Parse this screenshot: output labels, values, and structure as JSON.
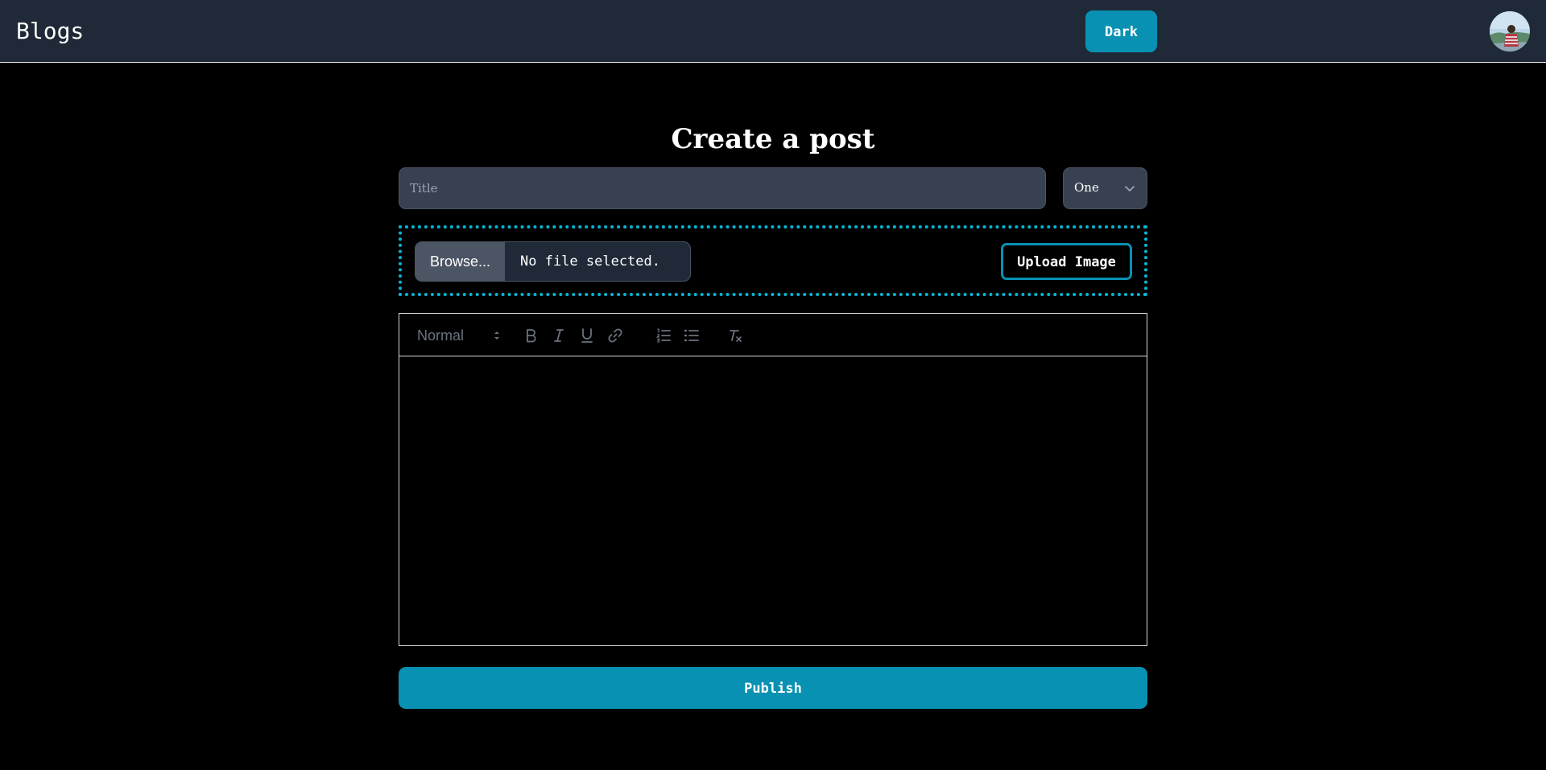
{
  "header": {
    "brand": "Blogs",
    "theme_button_label": "Dark",
    "avatar_icon": "user-avatar"
  },
  "main": {
    "heading": "Create a post",
    "title_input": {
      "placeholder": "Title",
      "value": ""
    },
    "category_select": {
      "selected": "One"
    },
    "upload": {
      "browse_label": "Browse...",
      "file_status": "No file selected.",
      "upload_button_label": "Upload Image"
    },
    "editor": {
      "heading_select": "Normal",
      "toolbar_icons": [
        "bold-icon",
        "italic-icon",
        "underline-icon",
        "link-icon",
        "ordered-list-icon",
        "bullet-list-icon",
        "clear-format-icon"
      ],
      "content": ""
    },
    "publish_label": "Publish"
  },
  "colors": {
    "accent": "#0891b2",
    "header_bg": "#1f2937",
    "input_bg": "#374151",
    "page_bg": "#000000"
  }
}
